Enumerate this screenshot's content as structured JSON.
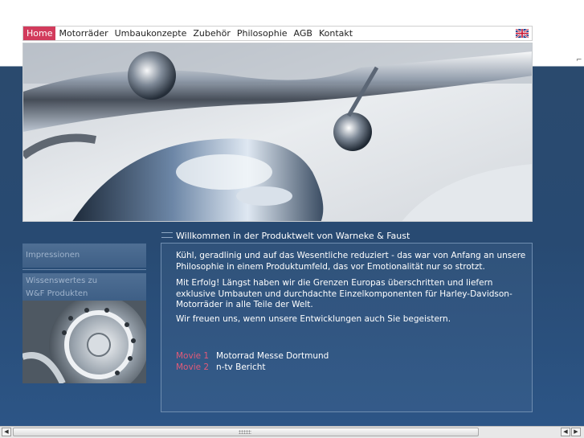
{
  "nav": {
    "items": [
      {
        "label": "Home",
        "active": true
      },
      {
        "label": "Motorräder",
        "active": false
      },
      {
        "label": "Umbaukonzepte",
        "active": false
      },
      {
        "label": "Zubehör",
        "active": false
      },
      {
        "label": "Philosophie",
        "active": false
      },
      {
        "label": "AGB",
        "active": false
      },
      {
        "label": "Kontakt",
        "active": false
      }
    ],
    "language_icon": "uk-flag-icon"
  },
  "sidebar": {
    "impressionen": "Impressionen",
    "wissen_line1": "Wissenswertes zu",
    "wissen_line2": "W&F Produkten"
  },
  "content": {
    "welcome": "Willkommen in der Produktwelt von Warneke & Faust",
    "paragraph1": "Kühl, geradlinig und auf das Wesentliche reduziert - das war von Anfang an unsere Philosophie in einem Produktumfeld, das vor Emotionalität nur so strotzt.",
    "paragraph2": "Mit Erfolg! Längst haben wir die Grenzen Europas überschritten und liefern exklusive Umbauten und durchdachte Einzelkomponenten für Harley-Davidson-Motorräder in alle Teile der Welt.",
    "paragraph3": "Wir freuen uns, wenn unsere Entwicklungen auch Sie begeistern.",
    "movies": [
      {
        "label": "Movie 1",
        "title": "Motorrad Messe Dortmund"
      },
      {
        "label": "Movie 2",
        "title": "n-tv Bericht"
      }
    ]
  },
  "colors": {
    "accent": "#d23b5c",
    "movie_label": "#e25a78",
    "background_blue": "#2a4a6e"
  }
}
